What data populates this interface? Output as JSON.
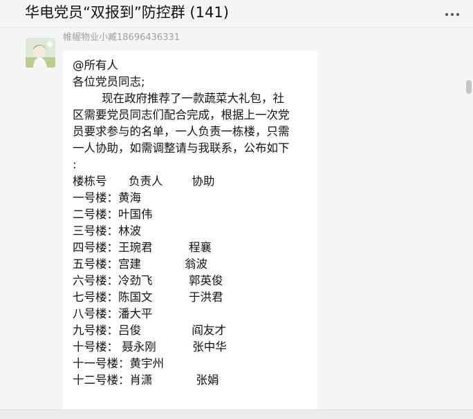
{
  "header": {
    "title": "华电党员“双报到”防控群 (141)",
    "more_icon": "more-horizontal-icon"
  },
  "message": {
    "sender": "帷幄物业小臧18696436331",
    "avatar_icon": "avatar-image",
    "lines": [
      "@所有人",
      "各位党员同志;",
      "        现在政府推荐了一款蔬菜大礼包，社",
      "区需要党员同志们配合完成，根据上一次党",
      "员要求参与的名单，一人负责一栋楼，只需",
      "一人协助，如需调整请与我联系，公布如下",
      ":",
      "楼栋号      负责人        协助",
      "一号楼：黄海",
      "二号楼：叶国伟",
      "三号楼：林波",
      "四号楼：王琬君          程襄",
      "五号楼：宫建            翁波",
      "六号楼：冷劲飞          郭英俊",
      "七号楼：陈国文          于洪君",
      "八号楼：潘大平",
      "九号楼：吕俊              阎友才",
      "十号楼： 聂永刚          张中华",
      "十一号楼：黄宇州",
      "十二号楼：肖潇            张娟"
    ]
  }
}
